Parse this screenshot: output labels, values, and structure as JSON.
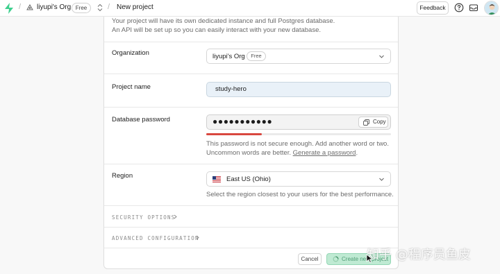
{
  "header": {
    "org_name": "liyupi's Org",
    "plan_badge": "Free",
    "page_title": "New project",
    "feedback_label": "Feedback"
  },
  "intro": {
    "line1": "Your project will have its own dedicated instance and full Postgres database.",
    "line2": "An API will be set up so you can easily interact with your new database."
  },
  "form": {
    "organization": {
      "label": "Organization",
      "value": "liyupi's Org",
      "badge": "Free"
    },
    "project_name": {
      "label": "Project name",
      "value": "study-hero"
    },
    "database_password": {
      "label": "Database password",
      "masked_value": "●●●●●●●●●●●",
      "copy_label": "Copy",
      "strength_fraction": 0.3,
      "hint_text": "This password is not secure enough. Add another word or two.",
      "hint_text2": "Uncommon words are better.",
      "generate_link": "Generate a password",
      "period": "."
    },
    "region": {
      "label": "Region",
      "value": "East US (Ohio)",
      "hint": "Select the region closest to your users for the best performance."
    }
  },
  "sections": {
    "security_options": "SECURITY OPTIONS",
    "advanced_configuration": "ADVANCED CONFIGURATION"
  },
  "footer": {
    "cancel_label": "Cancel",
    "create_label": "Create new project"
  },
  "watermark": "知乎 @程序员鱼皮",
  "colors": {
    "brand_green": "#3ecf8e",
    "strength_red": "#d9473f",
    "input_highlight": "#e9f1f8"
  }
}
